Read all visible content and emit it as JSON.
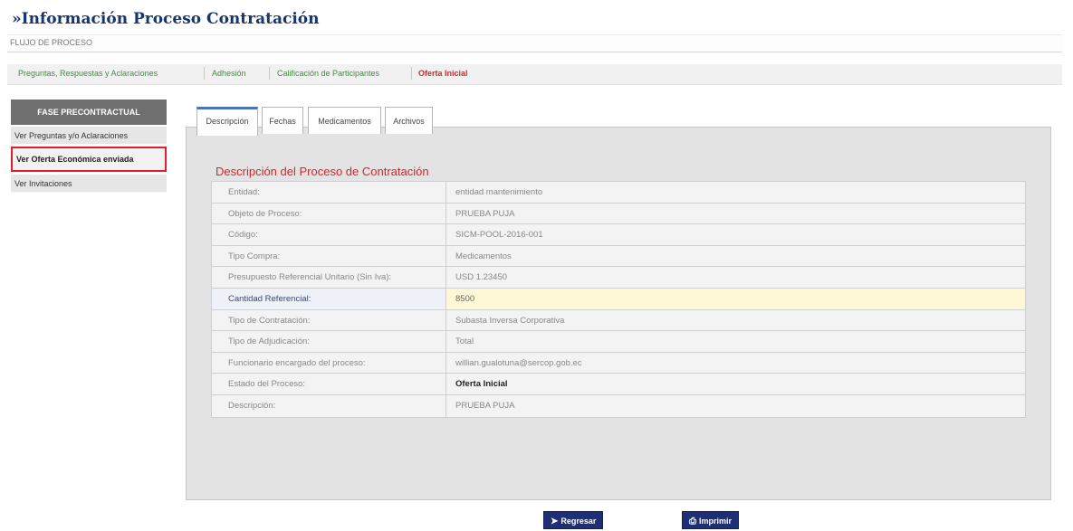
{
  "page": {
    "title": "»Información Proceso Contratación",
    "flow_label": "FLUJO DE PROCESO"
  },
  "stages": [
    {
      "label": "Preguntas, Respuestas y Aclaraciones"
    },
    {
      "label": "Adhesión"
    },
    {
      "label": "Calificación de Participantes"
    },
    {
      "label": "Oferta Inicial"
    }
  ],
  "sidebar": {
    "header": "FASE PRECONTRACTUAL",
    "items": [
      {
        "label": "Ver Preguntas y/o Aclaraciones"
      },
      {
        "label": "Ver Oferta Económica enviada"
      },
      {
        "label": "Ver Invitaciones"
      }
    ]
  },
  "tabs": [
    {
      "label": "Descripción"
    },
    {
      "label": "Fechas"
    },
    {
      "label": "Medicamentos"
    },
    {
      "label": "Archivos"
    }
  ],
  "section_title": "Descripción del Proceso de Contratación",
  "details": [
    {
      "label": "Entidad:",
      "value": "entidad mantenimiento"
    },
    {
      "label": "Objeto de Proceso:",
      "value": "PRUEBA PUJA"
    },
    {
      "label": "Código:",
      "value": "SICM-POOL-2016-001"
    },
    {
      "label": "Tipo Compra:",
      "value": "Medicamentos"
    },
    {
      "label": "Presupuesto Referencial Unitario (Sin Iva):",
      "value": "USD 1.23450"
    },
    {
      "label": "Cantidad Referencial:",
      "value": "8500"
    },
    {
      "label": "Tipo de Contratación:",
      "value": "Subasta Inversa Corporativa"
    },
    {
      "label": "Tipo de Adjudicación:",
      "value": "Total"
    },
    {
      "label": "Funcionario encargado del proceso:",
      "value": "willian.gualotuna@sercop.gob.ec"
    },
    {
      "label": "Estado del Proceso:",
      "value": "Oferta Inicial"
    },
    {
      "label": "Descripción:",
      "value": "PRUEBA PUJA"
    }
  ],
  "buttons": {
    "back": "Regresar",
    "print": "Imprimir"
  }
}
